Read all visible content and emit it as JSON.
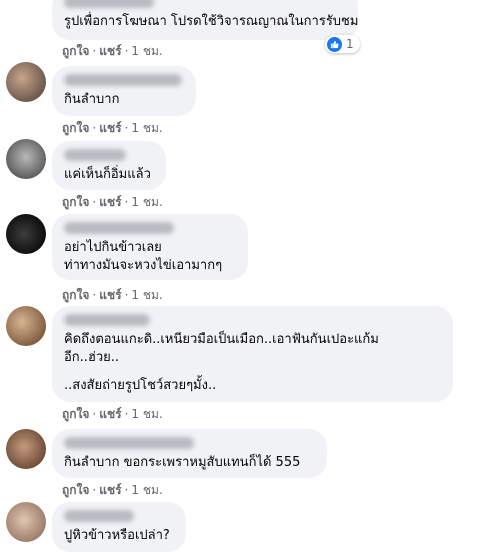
{
  "actions": {
    "like": "ถูกใจ",
    "reply": "แชร์",
    "separator": "·"
  },
  "comments": [
    {
      "lines": [
        "รูปเพื่อการโฆษณา โปรดใช้วิจารณญาณในการรับชม"
      ],
      "time": "1 ชม.",
      "reaction_count": "1"
    },
    {
      "lines": [
        "กินลำบาก"
      ],
      "time": "1 ชม."
    },
    {
      "lines": [
        "แค่เห็นก็อิ่มแล้ว"
      ],
      "time": "1 ชม."
    },
    {
      "lines": [
        "อย่าไปกินข้าวเลย",
        "ท่าทางมันจะหวงไข่เอามากๆ"
      ],
      "time": "1 ชม."
    },
    {
      "lines": [
        "คิดถึงตอนแกะดิ..เหนียวมือเป็นเมือก..เอาฟันกันเปอะแก้ม",
        "อีก..ฮ่วย..",
        "..สงสัยถ่ายรูปโชว์สวยๆมั้ง.."
      ],
      "time": "1 ชม."
    },
    {
      "lines": [
        "กินลำบาก ขอกระเพราหมูสับแทนก็ได้ 555"
      ],
      "time": "1 ชม."
    },
    {
      "lines": [
        "ปูหิวข้าวหรือเปล่า?"
      ]
    }
  ],
  "colors": {
    "bubble": "#f0f2f5",
    "secondary_text": "#65676b",
    "like_blue": "#1877f2"
  },
  "icons": {
    "reaction": "like-icon"
  }
}
